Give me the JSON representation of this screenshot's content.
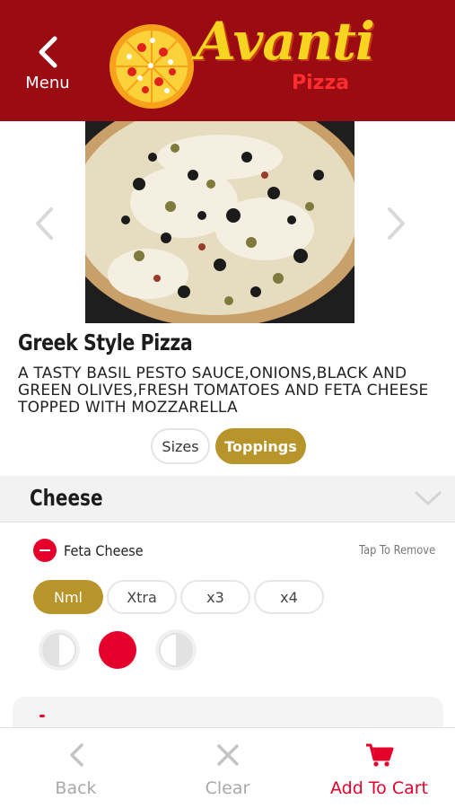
{
  "header": {
    "menu_label": "Menu",
    "logo_word": "Avanti",
    "logo_sub": "Pizza",
    "bg_color": "#9b0b12"
  },
  "carousel": {
    "prev_icon": "chevron-left-icon",
    "next_icon": "chevron-right-icon"
  },
  "item": {
    "title": "Greek Style Pizza",
    "description": "A TASTY BASIL PESTO SAUCE,ONIONS,BLACK AND GREEN OLIVES,FRESH TOMATOES AND FETA CHEESE TOPPED WITH MOZZARELLA"
  },
  "segments": {
    "sizes": "Sizes",
    "toppings": "Toppings",
    "selected": "Toppings"
  },
  "section": {
    "title": "Cheese",
    "toppings": [
      {
        "name": "Feta Cheese",
        "action_hint": "Tap To Remove",
        "quantity_options": [
          "Nml",
          "Xtra",
          "x3",
          "x4"
        ],
        "selected_quantity": "Nml",
        "portion_options": [
          "left-half",
          "whole",
          "right-half"
        ],
        "selected_portion": "whole"
      }
    ]
  },
  "bottom_bar": {
    "back_label": "Back",
    "clear_label": "Clear",
    "cart_label": "Add To Cart"
  },
  "colors": {
    "accent_gold": "#b8952a",
    "brand_red": "#e4002b",
    "header_red": "#9b0b12"
  }
}
